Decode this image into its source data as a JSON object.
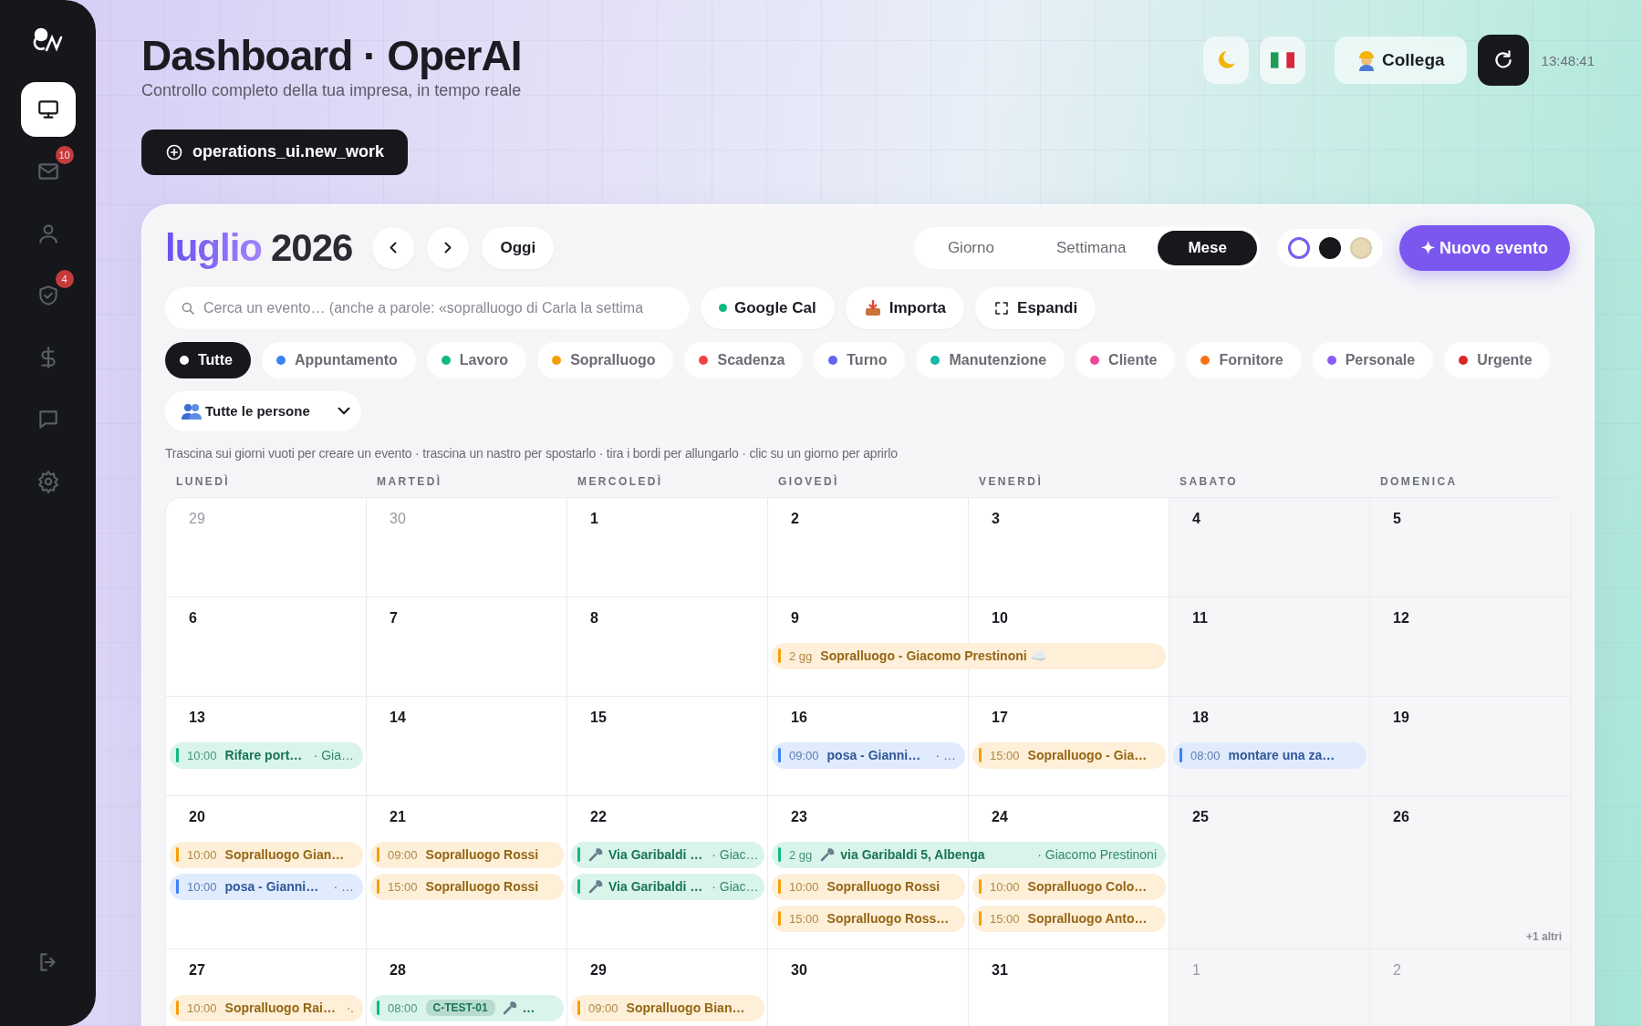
{
  "sidebar": {
    "items": [
      {
        "kind": "monitor",
        "selected": true
      },
      {
        "kind": "mail",
        "selected": false,
        "badge": "10"
      },
      {
        "kind": "user",
        "selected": false
      },
      {
        "kind": "shield",
        "selected": false,
        "badge": "4"
      },
      {
        "kind": "dollar",
        "selected": false
      },
      {
        "kind": "chat",
        "selected": false
      },
      {
        "kind": "gear",
        "selected": false
      },
      {
        "kind": "logout",
        "selected": false
      }
    ]
  },
  "header": {
    "title": "Dashboard · OperAI",
    "subtitle": "Controllo completo della tua impresa, in tempo reale",
    "new_work_button": "operations_ui.new_work",
    "connect_button": "Collega",
    "time": "13:48:41"
  },
  "calendar": {
    "month": "luglio",
    "year": "2026",
    "today_button": "Oggi",
    "views": [
      {
        "label": "Giorno",
        "selected": false
      },
      {
        "label": "Settimana",
        "selected": false
      },
      {
        "label": "Mese",
        "selected": true
      }
    ],
    "swatches": [
      {
        "color": "#ffffff",
        "selected": true
      },
      {
        "color": "#17181c",
        "selected": false
      },
      {
        "color": "#e6d9b4",
        "selected": false
      }
    ],
    "new_event_button": "✦ Nuovo evento",
    "search": {
      "placeholder": "Cerca un evento… (anche a parole: «sopralluogo di Carla la settima"
    },
    "actions": [
      {
        "kind": "google",
        "label": "Google Cal"
      },
      {
        "kind": "import",
        "label": "Importa"
      },
      {
        "kind": "expand",
        "label": "Espandi"
      }
    ],
    "filters": [
      {
        "label": "Tutte",
        "color": "#ffffff",
        "selected": true
      },
      {
        "label": "Appuntamento",
        "color": "#3b82f6",
        "selected": false
      },
      {
        "label": "Lavoro",
        "color": "#10b981",
        "selected": false
      },
      {
        "label": "Sopralluogo",
        "color": "#f59e0b",
        "selected": false
      },
      {
        "label": "Scadenza",
        "color": "#ef4444",
        "selected": false
      },
      {
        "label": "Turno",
        "color": "#6366f1",
        "selected": false
      },
      {
        "label": "Manutenzione",
        "color": "#14b8a6",
        "selected": false
      },
      {
        "label": "Cliente",
        "color": "#ec4899",
        "selected": false
      },
      {
        "label": "Fornitore",
        "color": "#f97316",
        "selected": false
      },
      {
        "label": "Personale",
        "color": "#8b5cf6",
        "selected": false
      },
      {
        "label": "Urgente",
        "color": "#dc2626",
        "selected": false
      }
    ],
    "people_select": "Tutte le persone",
    "hint": "Trascina sui giorni vuoti per creare un evento · trascina un nastro per spostarlo · tira i bordi per allungarlo · clic su un giorno per aprirlo",
    "weekdays": [
      "LUNEDÌ",
      "MARTEDÌ",
      "MERCOLEDÌ",
      "GIOVEDÌ",
      "VENERDÌ",
      "SABATO",
      "DOMENICA"
    ],
    "weeks": [
      {
        "days": [
          {
            "number": "29",
            "outside": true
          },
          {
            "number": "30",
            "outside": true
          },
          {
            "number": "1",
            "outside": false
          },
          {
            "number": "2",
            "outside": false
          },
          {
            "number": "3",
            "outside": false
          },
          {
            "number": "4",
            "outside": false
          },
          {
            "number": "5",
            "outside": false
          }
        ]
      },
      {
        "days": [
          {
            "number": "6",
            "outside": false
          },
          {
            "number": "7",
            "outside": false
          },
          {
            "number": "8",
            "outside": false
          },
          {
            "number": "9",
            "outside": false,
            "events": [
              {
                "kind": "event",
                "multi_day": true,
                "color": "#f59e0b",
                "time": "2 gg",
                "title": "Sopralluogo - Giacomo Prestinoni ☁️"
              }
            ]
          },
          {
            "number": "10",
            "outside": false
          },
          {
            "number": "11",
            "outside": false
          },
          {
            "number": "12",
            "outside": false
          }
        ]
      },
      {
        "days": [
          {
            "number": "13",
            "outside": false,
            "events": [
              {
                "kind": "event",
                "multi_day": false,
                "color": "#10b981",
                "time": "10:00",
                "title": "Rifare port…",
                "person": "· Gia…"
              }
            ]
          },
          {
            "number": "14",
            "outside": false
          },
          {
            "number": "15",
            "outside": false
          },
          {
            "number": "16",
            "outside": false,
            "events": [
              {
                "kind": "event",
                "multi_day": false,
                "color": "#3b82f6",
                "time": "09:00",
                "title": "posa - Gianni…",
                "person": "· …"
              }
            ]
          },
          {
            "number": "17",
            "outside": false,
            "events": [
              {
                "kind": "event",
                "multi_day": false,
                "color": "#f59e0b",
                "time": "15:00",
                "title": "Sopralluogo - Gia…"
              }
            ]
          },
          {
            "number": "18",
            "outside": false,
            "events": [
              {
                "kind": "event",
                "multi_day": false,
                "color": "#3b82f6",
                "time": "08:00",
                "title": "montare una za…"
              }
            ]
          },
          {
            "number": "19",
            "outside": false
          }
        ]
      },
      {
        "days": [
          {
            "number": "20",
            "outside": false,
            "events": [
              {
                "kind": "event",
                "multi_day": false,
                "color": "#f59e0b",
                "time": "10:00",
                "title": "Sopralluogo Gian…"
              },
              {
                "kind": "event",
                "multi_day": false,
                "color": "#3b82f6",
                "time": "10:00",
                "title": "posa - Gianni…",
                "person": "· …"
              }
            ]
          },
          {
            "number": "21",
            "outside": false,
            "events": [
              {
                "kind": "event",
                "multi_day": false,
                "color": "#f59e0b",
                "time": "09:00",
                "title": "Sopralluogo Rossi"
              },
              {
                "kind": "event",
                "multi_day": false,
                "color": "#f59e0b",
                "time": "15:00",
                "title": "Sopralluogo Rossi"
              }
            ]
          },
          {
            "number": "22",
            "outside": false,
            "events": [
              {
                "kind": "job",
                "multi_day": false,
                "color": "#10b981",
                "title": "Via Garibaldi …",
                "person": "· Giac…"
              },
              {
                "kind": "job",
                "multi_day": false,
                "color": "#10b981",
                "title": "Via Garibaldi …",
                "person": "· Giac…"
              }
            ]
          },
          {
            "number": "23",
            "outside": false,
            "events": [
              {
                "kind": "job",
                "multi_day": true,
                "color": "#10b981",
                "time": "2 gg",
                "title": "via Garibaldi 5, Albenga",
                "person": "· Giacomo Prestinoni"
              },
              {
                "kind": "event",
                "multi_day": false,
                "color": "#f59e0b",
                "time": "10:00",
                "title": "Sopralluogo Rossi"
              },
              {
                "kind": "event",
                "multi_day": false,
                "color": "#f59e0b",
                "time": "15:00",
                "title": "Sopralluogo Ross…"
              }
            ]
          },
          {
            "number": "24",
            "outside": false,
            "events": [
              {
                "kind": "event",
                "multi_day": false,
                "color": "#f59e0b",
                "time": "10:00",
                "title": "Sopralluogo Colo…"
              },
              {
                "kind": "event",
                "multi_day": false,
                "color": "#f59e0b",
                "time": "15:00",
                "title": "Sopralluogo Anto…"
              }
            ]
          },
          {
            "number": "25",
            "outside": false
          },
          {
            "number": "26",
            "outside": false,
            "more": "+1 altri"
          }
        ]
      },
      {
        "days": [
          {
            "number": "27",
            "outside": false,
            "events": [
              {
                "kind": "event",
                "multi_day": false,
                "color": "#f59e0b",
                "time": "10:00",
                "title": "Sopralluogo Rai…",
                "person": "·."
              }
            ]
          },
          {
            "number": "28",
            "outside": false,
            "events": [
              {
                "kind": "job",
                "multi_day": false,
                "color": "#10b981",
                "time": "08:00",
                "tag": "C-TEST-01",
                "title": "…"
              }
            ]
          },
          {
            "number": "29",
            "outside": false,
            "events": [
              {
                "kind": "event",
                "multi_day": false,
                "color": "#f59e0b",
                "time": "09:00",
                "title": "Sopralluogo Bian…"
              }
            ]
          },
          {
            "number": "30",
            "outside": false
          },
          {
            "number": "31",
            "outside": false
          },
          {
            "number": "1",
            "outside": true
          },
          {
            "number": "2",
            "outside": true
          }
        ]
      }
    ]
  }
}
